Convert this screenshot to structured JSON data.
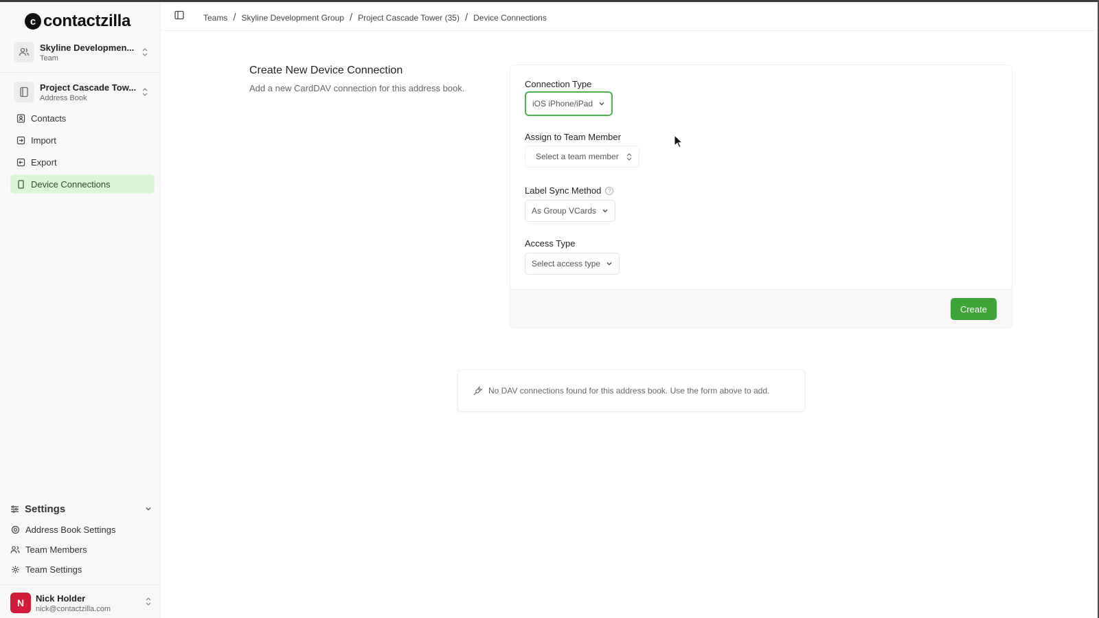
{
  "app": {
    "name": "contactzilla"
  },
  "sidebar": {
    "team_switcher": {
      "title": "Skyline Developmen...",
      "subtitle": "Team",
      "icon": "users-icon"
    },
    "book_switcher": {
      "title": "Project Cascade Tow...",
      "subtitle": "Address Book",
      "icon": "book-icon"
    },
    "nav": [
      {
        "label": "Contacts",
        "icon": "contacts-icon"
      },
      {
        "label": "Import",
        "icon": "import-icon"
      },
      {
        "label": "Export",
        "icon": "export-icon"
      },
      {
        "label": "Device Connections",
        "icon": "device-icon",
        "active": true
      }
    ],
    "settings": {
      "label": "Settings",
      "items": [
        {
          "label": "Address Book Settings",
          "icon": "gear-icon"
        },
        {
          "label": "Team Members",
          "icon": "users-icon"
        },
        {
          "label": "Team Settings",
          "icon": "gear-icon"
        }
      ]
    },
    "user": {
      "initial": "N",
      "name": "Nick Holder",
      "email": "nick@contactzilla.com"
    }
  },
  "breadcrumb": [
    "Teams",
    "Skyline Development Group",
    "Project Cascade Tower (35)",
    "Device Connections"
  ],
  "section": {
    "title": "Create New Device Connection",
    "description": "Add a new CardDAV connection for this address book."
  },
  "form": {
    "connection_type": {
      "label": "Connection Type",
      "value": "iOS iPhone/iPad"
    },
    "team_member": {
      "label": "Assign to Team Member",
      "placeholder": "Select a team member"
    },
    "label_sync": {
      "label": "Label Sync Method",
      "value": "As Group VCards"
    },
    "access_type": {
      "label": "Access Type",
      "placeholder": "Select access type"
    },
    "create_label": "Create"
  },
  "empty_state": {
    "message": "No DAV connections found for this address book. Use the form above to add."
  },
  "colors": {
    "accent": "#3ea437",
    "active_nav_bg": "#dcf5d8",
    "avatar": "#d01c3a"
  }
}
